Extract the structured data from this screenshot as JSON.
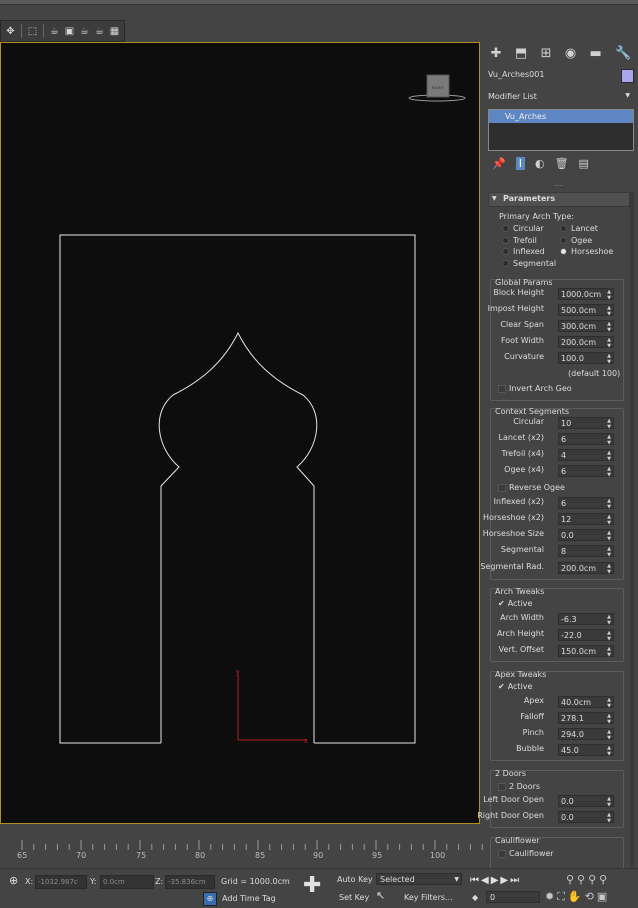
{
  "colors": {
    "accent": "#5d86c2",
    "viewport_bg": "#0d0d0d",
    "viewport_border": "#b28f22",
    "panel_bg": "#444444"
  },
  "toolbar": {
    "icons": [
      "move-icon",
      "select-icon",
      "lasso-icon",
      "render-icon",
      "picture-icon",
      "teapot-icon",
      "render-frame-icon",
      "grid-icon"
    ]
  },
  "viewcube": {
    "label": "RIGHT"
  },
  "viewport": {
    "axis_y": "y",
    "axis_x": "x"
  },
  "ruler": {
    "ticks": [
      "65",
      "70",
      "75",
      "80",
      "85",
      "90",
      "95",
      "100"
    ]
  },
  "status": {
    "x_label": "X:",
    "x_value": "-1032.987c",
    "y_label": "Y:",
    "y_value": "0.0cm",
    "z_label": "Z:",
    "z_value": "-35.836cm",
    "grid": "Grid = 1000.0cm",
    "add_time_tag": "Add Time Tag",
    "auto_key": "Auto Key",
    "selected": "Selected",
    "set_key": "Set Key",
    "key_filters": "Key Filters...",
    "frame": "0"
  },
  "panel": {
    "object_name": "Vu_Arches001",
    "object_color": "#a9a6f0",
    "modifier_list": "Modifier List",
    "stack_item": "Vu_Arches",
    "rollout_title": "Parameters",
    "primary_arch_type": "Primary Arch Type:",
    "arch_types": [
      {
        "label": "Circular",
        "selected": false
      },
      {
        "label": "Lancet",
        "selected": false
      },
      {
        "label": "Trefoil",
        "selected": false
      },
      {
        "label": "Ogee",
        "selected": false
      },
      {
        "label": "Inflexed",
        "selected": false
      },
      {
        "label": "Horseshoe",
        "selected": true
      },
      {
        "label": "Segmental",
        "selected": false
      }
    ],
    "global_params": {
      "title": "Global Params",
      "fields": [
        {
          "label": "Block Height",
          "value": "1000.0cm"
        },
        {
          "label": "Impost Height",
          "value": "500.0cm"
        },
        {
          "label": "Clear Span",
          "value": "300.0cm"
        },
        {
          "label": "Foot Width",
          "value": "200.0cm"
        },
        {
          "label": "Curvature",
          "value": "100.0"
        }
      ],
      "default_note": "(default 100)",
      "invert": "Invert Arch Geo"
    },
    "context_segments": {
      "title": "Context Segments",
      "fields": [
        {
          "label": "Circular",
          "value": "10"
        },
        {
          "label": "Lancet (x2)",
          "value": "6"
        },
        {
          "label": "Trefoil (x4)",
          "value": "4"
        },
        {
          "label": "Ogee (x4)",
          "value": "6"
        }
      ],
      "reverse_ogee": "Reverse Ogee",
      "fields2": [
        {
          "label": "Inflexed (x2)",
          "value": "6"
        },
        {
          "label": "Horseshoe (x2)",
          "value": "12"
        },
        {
          "label": "Horseshoe Size",
          "value": "0.0"
        },
        {
          "label": "Segmental",
          "value": "8"
        },
        {
          "label": "Segmental Rad.",
          "value": "200.0cm"
        }
      ]
    },
    "arch_tweaks": {
      "title": "Arch Tweaks",
      "active": "Active",
      "fields": [
        {
          "label": "Arch Width",
          "value": "-6.3"
        },
        {
          "label": "Arch Height",
          "value": "-22.0"
        },
        {
          "label": "Vert. Offset",
          "value": "150.0cm"
        }
      ]
    },
    "apex_tweaks": {
      "title": "Apex Tweaks",
      "active": "Active",
      "fields": [
        {
          "label": "Apex",
          "value": "40.0cm"
        },
        {
          "label": "Falloff",
          "value": "278.1"
        },
        {
          "label": "Pinch",
          "value": "294.0"
        },
        {
          "label": "Bubble",
          "value": "45.0"
        }
      ]
    },
    "two_doors": {
      "title": "2 Doors",
      "checkbox": "2 Doors",
      "fields": [
        {
          "label": "Left Door Open",
          "value": "0.0"
        },
        {
          "label": "Right Door Open",
          "value": "0.0"
        }
      ]
    },
    "cauliflower": {
      "title": "Cauliflower",
      "checkbox": "Cauliflower"
    }
  }
}
